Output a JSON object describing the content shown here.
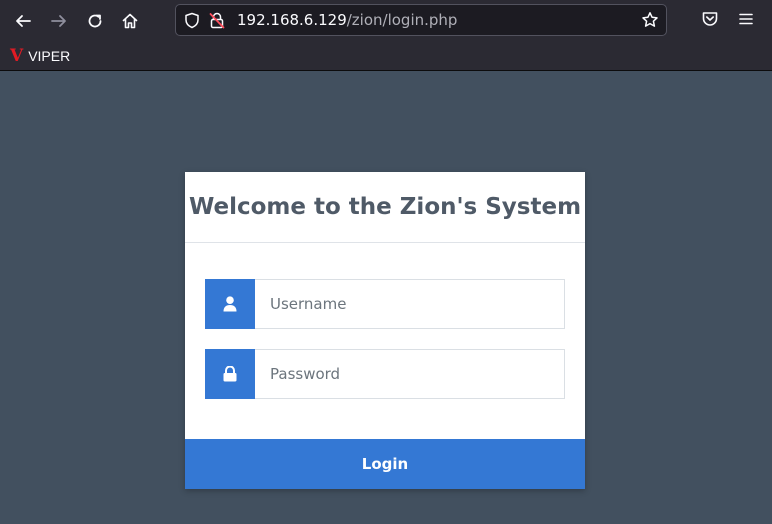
{
  "browser": {
    "url_host": "192.168.6.129",
    "url_path": "/zion/login.php",
    "icons": [
      "back-arrow-icon",
      "forward-arrow-icon",
      "reload-icon",
      "home-icon",
      "shield-icon",
      "insecure-lock-icon",
      "star-icon",
      "pocket-icon",
      "hamburger-menu-icon"
    ],
    "bookmarks": [
      {
        "logo": "V",
        "label": "VIPER"
      }
    ]
  },
  "page": {
    "background_color": "#42505f",
    "accent_color": "#3478d4"
  },
  "login": {
    "title": "Welcome to the Zion's System",
    "username_placeholder": "Username",
    "username_value": "",
    "password_placeholder": "Password",
    "password_value": "",
    "submit_label": "Login"
  }
}
